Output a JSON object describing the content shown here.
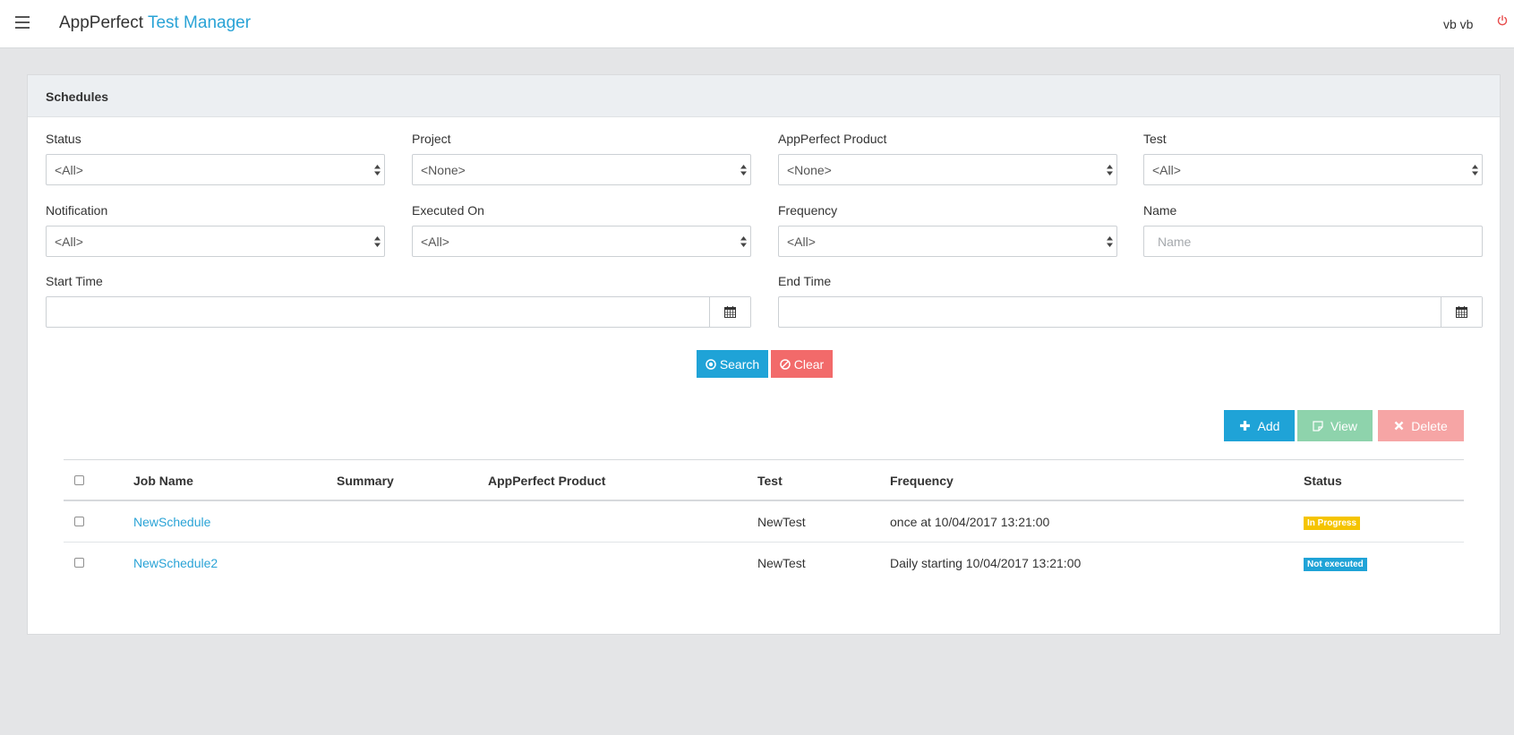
{
  "navbar": {
    "brand_main": "AppPerfect",
    "brand_accent": "Test Manager",
    "user": "vb vb"
  },
  "panel": {
    "title": "Schedules"
  },
  "filters": {
    "status": {
      "label": "Status",
      "value": "<All>"
    },
    "project": {
      "label": "Project",
      "value": "<None>"
    },
    "product": {
      "label": "AppPerfect Product",
      "value": "<None>"
    },
    "test": {
      "label": "Test",
      "value": "<All>"
    },
    "notification": {
      "label": "Notification",
      "value": "<All>"
    },
    "executed_on": {
      "label": "Executed On",
      "value": "<All>"
    },
    "frequency": {
      "label": "Frequency",
      "value": "<All>"
    },
    "name": {
      "label": "Name",
      "placeholder": "Name",
      "value": ""
    },
    "start_time": {
      "label": "Start Time",
      "value": ""
    },
    "end_time": {
      "label": "End Time",
      "value": ""
    }
  },
  "actions": {
    "search": "Search",
    "clear": "Clear",
    "add": "Add",
    "view": "View",
    "delete": "Delete"
  },
  "table": {
    "headers": {
      "job_name": "Job Name",
      "summary": "Summary",
      "product": "AppPerfect Product",
      "test": "Test",
      "frequency": "Frequency",
      "status": "Status"
    },
    "rows": [
      {
        "job_name": "NewSchedule",
        "summary": "",
        "product": "",
        "test": "NewTest",
        "frequency": "once at 10/04/2017 13:21:00",
        "status": "In Progress",
        "status_color": "#f5c400"
      },
      {
        "job_name": "NewSchedule2",
        "summary": "",
        "product": "",
        "test": "NewTest",
        "frequency": "Daily starting 10/04/2017 13:21:00",
        "status": "Not executed",
        "status_color": "#1fa3d7"
      }
    ]
  },
  "colors": {
    "accent": "#2aa3d6",
    "danger": "#f26a6a",
    "power_icon": "#e84c4c"
  }
}
